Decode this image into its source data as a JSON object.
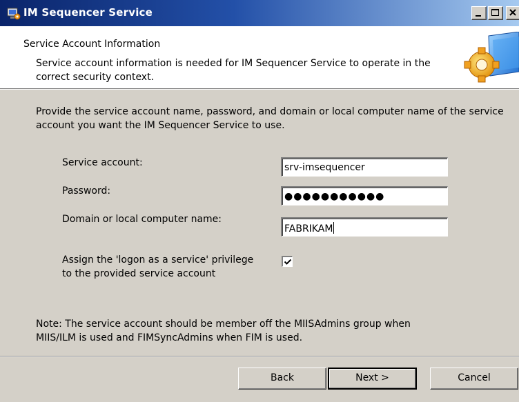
{
  "window": {
    "title": "IM Sequencer Service",
    "controls": {
      "minimize_icon": "minimize-icon",
      "maximize_icon": "maximize-icon",
      "close_icon": "close-icon"
    }
  },
  "header": {
    "title": "Service Account Information",
    "description": "Service account information is needed for IM Sequencer Service to operate in the correct security context.",
    "graphic": "gear-monitor-icon"
  },
  "form": {
    "intro": "Provide the service account name, password, and domain or local computer name of the service account you want the IM Sequencer Service to use.",
    "service_account": {
      "label": "Service account:",
      "value": "srv-imsequencer"
    },
    "password": {
      "label": "Password:",
      "value": "●●●●●●●●●●●"
    },
    "domain": {
      "label": "Domain or local computer name:",
      "value": "FABRIKAM"
    },
    "privilege": {
      "label_line1": "Assign the 'logon as a service' privilege",
      "label_line2": "to the provided service account",
      "checked": true
    },
    "note_line1": "Note: The service account should be member off the MIISAdmins group when",
    "note_line2": "MIIS/ILM is used and FIMSyncAdmins when FIM is used."
  },
  "buttons": {
    "back": "Back",
    "next": "Next >",
    "cancel": "Cancel"
  },
  "colors": {
    "titlebar_start": "#0a246a",
    "titlebar_end": "#a6caf0",
    "dialog_bg": "#d4d0c8",
    "header_bg": "#ffffff"
  }
}
